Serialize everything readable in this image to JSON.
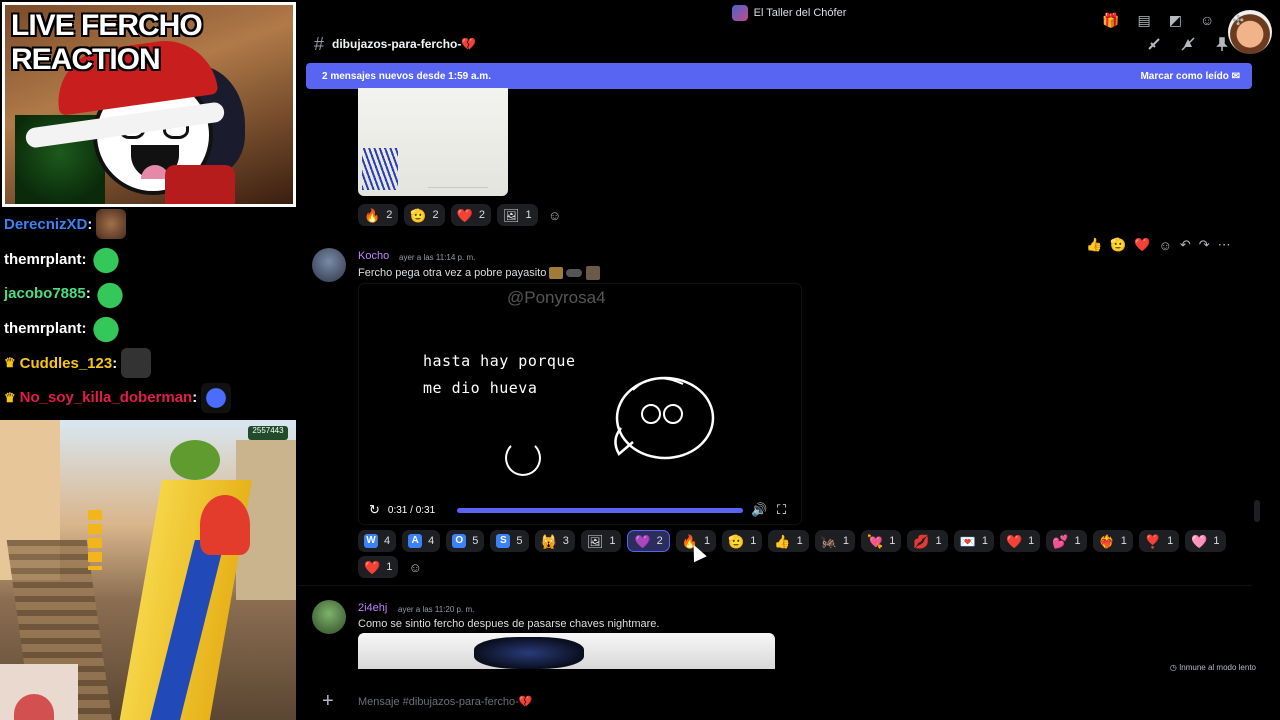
{
  "stream": {
    "cam_title": "LIVE FERCHO REACTION",
    "chat": [
      {
        "user": "DerecnizXD",
        "sep": ":",
        "color": "#3b82f6",
        "crown": false,
        "emote": "face"
      },
      {
        "user": "themrplant",
        "sep": ":",
        "color": "#ffffff",
        "crown": false,
        "emote": "apple"
      },
      {
        "user": "jacobo7885",
        "sep": ":",
        "color": "#4ade80",
        "crown": false,
        "emote": "apple"
      },
      {
        "user": "themrplant",
        "sep": ":",
        "color": "#ffffff",
        "crown": false,
        "emote": "apple"
      },
      {
        "user": "Cuddles_123",
        "sep": ":",
        "color": "#f5c518",
        "crown": true,
        "emote": "cat"
      },
      {
        "user": "No_soy_killa_doberman",
        "sep": ":",
        "color": "#e11d48",
        "crown": true,
        "emote": "blue"
      }
    ],
    "game_score": "2557443"
  },
  "discord": {
    "server_name": "El Taller del Chófer",
    "channel_name": "dibujazos-para-fercho-💔",
    "new_banner": {
      "text": "2 mensajes nuevos desde 1:59 a.m.",
      "action": "Marcar como leído"
    },
    "first_reactions": [
      {
        "emoji": "🔥",
        "count": "2"
      },
      {
        "emoji": "🫡",
        "count": "2"
      },
      {
        "emoji": "❤️",
        "count": "2"
      },
      {
        "emoji": "🖼",
        "count": "1"
      }
    ],
    "message1": {
      "author": "Kocho",
      "author_color": "#c084fc",
      "time": "ayer a las 11:14 p. m.",
      "text": "Fercho pega otra vez a  pobre payasito"
    },
    "video": {
      "watermark": "@Ponyrosa4",
      "line1": "hasta hay porque",
      "line2": "me dio hueva",
      "time": "0:31 / 0:31"
    },
    "message1_reactions": [
      {
        "label": "W",
        "count": "4",
        "type": "box",
        "color": "#3b82f6"
      },
      {
        "label": "A",
        "count": "4",
        "type": "box",
        "color": "#3b82f6"
      },
      {
        "label": "O",
        "count": "5",
        "type": "box",
        "color": "#3b82f6"
      },
      {
        "label": "S",
        "count": "5",
        "type": "box",
        "color": "#3b82f6"
      },
      {
        "label": "🙀",
        "count": "3",
        "type": "emoji"
      },
      {
        "label": "🖼",
        "count": "1",
        "type": "emoji"
      },
      {
        "label": "💜",
        "count": "2",
        "type": "emoji",
        "mine": true
      },
      {
        "label": "🔥",
        "count": "1",
        "type": "emoji"
      },
      {
        "label": "🫡",
        "count": "1",
        "type": "emoji"
      },
      {
        "label": "👍",
        "count": "1",
        "type": "emoji"
      },
      {
        "label": "🦗",
        "count": "1",
        "type": "emoji"
      },
      {
        "label": "💘",
        "count": "1",
        "type": "emoji"
      },
      {
        "label": "💋",
        "count": "1",
        "type": "emoji"
      },
      {
        "label": "💌",
        "count": "1",
        "type": "emoji"
      },
      {
        "label": "❤️",
        "count": "1",
        "type": "emoji"
      },
      {
        "label": "💕",
        "count": "1",
        "type": "emoji"
      },
      {
        "label": "❤️‍🔥",
        "count": "1",
        "type": "emoji"
      },
      {
        "label": "❣️",
        "count": "1",
        "type": "emoji"
      },
      {
        "label": "🩷",
        "count": "1",
        "type": "emoji"
      },
      {
        "label": "❤️",
        "count": "1",
        "type": "emoji"
      }
    ],
    "message2": {
      "author": "2i4ehj",
      "author_color": "#c084fc",
      "time": "ayer a las 11:20 p. m.",
      "text": "Como se sintio fercho despues de pasarse chaves nightmare."
    },
    "slowmode": "Inmune al modo lento",
    "composer_placeholder": "Mensaje #dibujazos-para-fercho-💔",
    "icons": {
      "hash": "#",
      "add": "+",
      "add_reaction": "☺",
      "more": "⋯",
      "reply": "↶",
      "forward": "↷"
    }
  }
}
